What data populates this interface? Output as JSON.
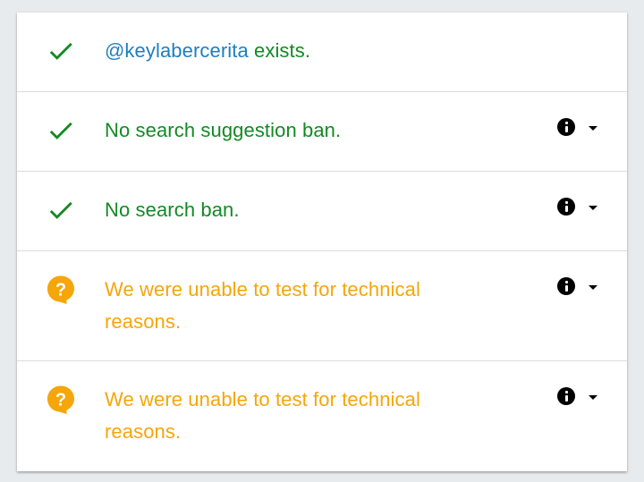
{
  "results": [
    {
      "status": "ok",
      "icon": "check-icon",
      "handle": "@keylabercerita",
      "text": " exists.",
      "has_info": false
    },
    {
      "status": "ok",
      "icon": "check-icon",
      "text": "No search suggestion ban.",
      "has_info": true
    },
    {
      "status": "ok",
      "icon": "check-icon",
      "text": "No search ban.",
      "has_info": true
    },
    {
      "status": "unknown",
      "icon": "help-bubble-icon",
      "text": "We were unable to test for technical reasons.",
      "has_info": true
    },
    {
      "status": "unknown",
      "icon": "help-bubble-icon",
      "text": "We were unable to test for technical reasons.",
      "has_info": true
    }
  ],
  "colors": {
    "ok": "#118a23",
    "warn": "#f5a60a",
    "handle": "#1e7fc0",
    "background": "#e8ebee",
    "card": "#ffffff",
    "divider": "#dcdcdc"
  }
}
